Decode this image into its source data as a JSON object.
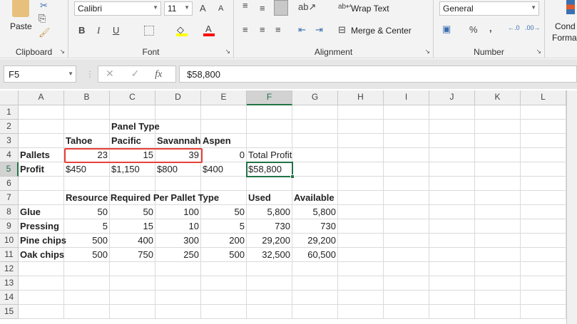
{
  "ribbon": {
    "clipboard": {
      "label": "Clipboard",
      "paste": "Paste"
    },
    "font": {
      "label": "Font",
      "name": "Calibri",
      "size": "11",
      "bold": "B",
      "italic": "I",
      "underline": "U",
      "grow": "A",
      "shrink": "A",
      "font_color": "A",
      "fill_color": "#ffff00",
      "text_color": "#ff0000"
    },
    "alignment": {
      "label": "Alignment",
      "wrap_text": "Wrap Text",
      "merge_center": "Merge & Center"
    },
    "number": {
      "label": "Number",
      "format": "General",
      "percent": "%",
      "comma": ","
    },
    "styles": {
      "conditional_line1": "Cond",
      "conditional_line2": "Forma"
    }
  },
  "formula_bar": {
    "name_box": "F5",
    "cancel": "✕",
    "enter": "✓",
    "fx": "fx",
    "value": "$58,800"
  },
  "columns": [
    "A",
    "B",
    "C",
    "D",
    "E",
    "F",
    "G",
    "H",
    "I",
    "J",
    "K",
    "L"
  ],
  "selected_cell": {
    "col": "F",
    "row": 5
  },
  "highlight_range": "B4:D4",
  "highlight_color": "#e8413a",
  "accent": "#217346",
  "rows": [
    {
      "n": "1",
      "cells": {}
    },
    {
      "n": "2",
      "cells": {
        "C": {
          "v": "Panel Type",
          "b": 1
        }
      }
    },
    {
      "n": "3",
      "cells": {
        "B": {
          "v": "Tahoe",
          "b": 1
        },
        "C": {
          "v": "Pacific",
          "b": 1
        },
        "D": {
          "v": "Savannah",
          "b": 1
        },
        "E": {
          "v": "Aspen",
          "b": 1
        }
      }
    },
    {
      "n": "4",
      "cells": {
        "A": {
          "v": "Pallets",
          "b": 1
        },
        "B": {
          "v": "23",
          "r": 1
        },
        "C": {
          "v": "15",
          "r": 1
        },
        "D": {
          "v": "39",
          "r": 1
        },
        "E": {
          "v": "0",
          "r": 1
        },
        "F": {
          "v": "Total Profit"
        }
      }
    },
    {
      "n": "5",
      "cells": {
        "A": {
          "v": "Profit",
          "b": 1
        },
        "B": {
          "v": "$450"
        },
        "C": {
          "v": "$1,150"
        },
        "D": {
          "v": "$800"
        },
        "E": {
          "v": "$400"
        },
        "F": {
          "v": "$58,800"
        }
      }
    },
    {
      "n": "6",
      "cells": {}
    },
    {
      "n": "7",
      "cells": {
        "B": {
          "v": "Resource Required Per Pallet Type",
          "b": 1
        },
        "F": {
          "v": "Used",
          "b": 1
        },
        "G": {
          "v": "Available",
          "b": 1
        }
      }
    },
    {
      "n": "8",
      "cells": {
        "A": {
          "v": "Glue",
          "b": 1
        },
        "B": {
          "v": "50",
          "r": 1
        },
        "C": {
          "v": "50",
          "r": 1
        },
        "D": {
          "v": "100",
          "r": 1
        },
        "E": {
          "v": "50",
          "r": 1
        },
        "F": {
          "v": "5,800",
          "r": 1
        },
        "G": {
          "v": "5,800",
          "r": 1
        }
      }
    },
    {
      "n": "9",
      "cells": {
        "A": {
          "v": "Pressing",
          "b": 1
        },
        "B": {
          "v": "5",
          "r": 1
        },
        "C": {
          "v": "15",
          "r": 1
        },
        "D": {
          "v": "10",
          "r": 1
        },
        "E": {
          "v": "5",
          "r": 1
        },
        "F": {
          "v": "730",
          "r": 1
        },
        "G": {
          "v": "730",
          "r": 1
        }
      }
    },
    {
      "n": "10",
      "cells": {
        "A": {
          "v": "Pine chips",
          "b": 1
        },
        "B": {
          "v": "500",
          "r": 1
        },
        "C": {
          "v": "400",
          "r": 1
        },
        "D": {
          "v": "300",
          "r": 1
        },
        "E": {
          "v": "200",
          "r": 1
        },
        "F": {
          "v": "29,200",
          "r": 1
        },
        "G": {
          "v": "29,200",
          "r": 1
        }
      }
    },
    {
      "n": "11",
      "cells": {
        "A": {
          "v": "Oak chips",
          "b": 1
        },
        "B": {
          "v": "500",
          "r": 1
        },
        "C": {
          "v": "750",
          "r": 1
        },
        "D": {
          "v": "250",
          "r": 1
        },
        "E": {
          "v": "500",
          "r": 1
        },
        "F": {
          "v": "32,500",
          "r": 1
        },
        "G": {
          "v": "60,500",
          "r": 1
        }
      }
    },
    {
      "n": "12",
      "cells": {}
    },
    {
      "n": "13",
      "cells": {}
    },
    {
      "n": "14",
      "cells": {}
    },
    {
      "n": "15",
      "cells": {}
    }
  ]
}
